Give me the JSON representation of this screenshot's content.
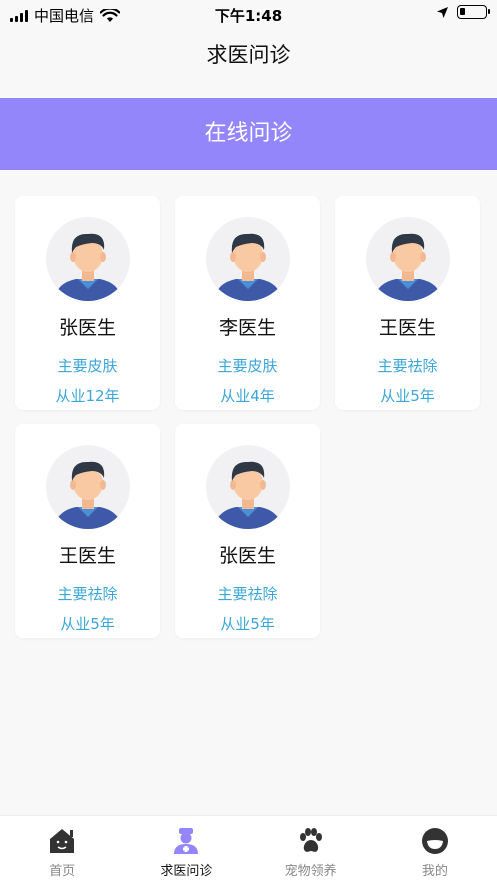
{
  "status_bar": {
    "carrier": "中国电信",
    "time": "下午1:48"
  },
  "header": {
    "title": "求医问诊"
  },
  "banner": {
    "label": "在线问诊"
  },
  "doctors": [
    {
      "name": "张医生",
      "specialty": "主要皮肤",
      "experience": "从业12年"
    },
    {
      "name": "李医生",
      "specialty": "主要皮肤",
      "experience": "从业4年"
    },
    {
      "name": "王医生",
      "specialty": "主要祛除",
      "experience": "从业5年"
    },
    {
      "name": "王医生",
      "specialty": "主要祛除",
      "experience": "从业5年"
    },
    {
      "name": "张医生",
      "specialty": "主要祛除",
      "experience": "从业5年"
    }
  ],
  "tab_bar": {
    "items": [
      {
        "label": "首页",
        "icon": "home-icon"
      },
      {
        "label": "求医问诊",
        "icon": "doctor-icon",
        "active": true
      },
      {
        "label": "宠物领养",
        "icon": "paw-icon"
      },
      {
        "label": "我的",
        "icon": "profile-icon"
      }
    ]
  },
  "colors": {
    "banner": "#9386fb",
    "accent_text": "#3ba6d8",
    "active_tab_icon": "#9386fb"
  }
}
